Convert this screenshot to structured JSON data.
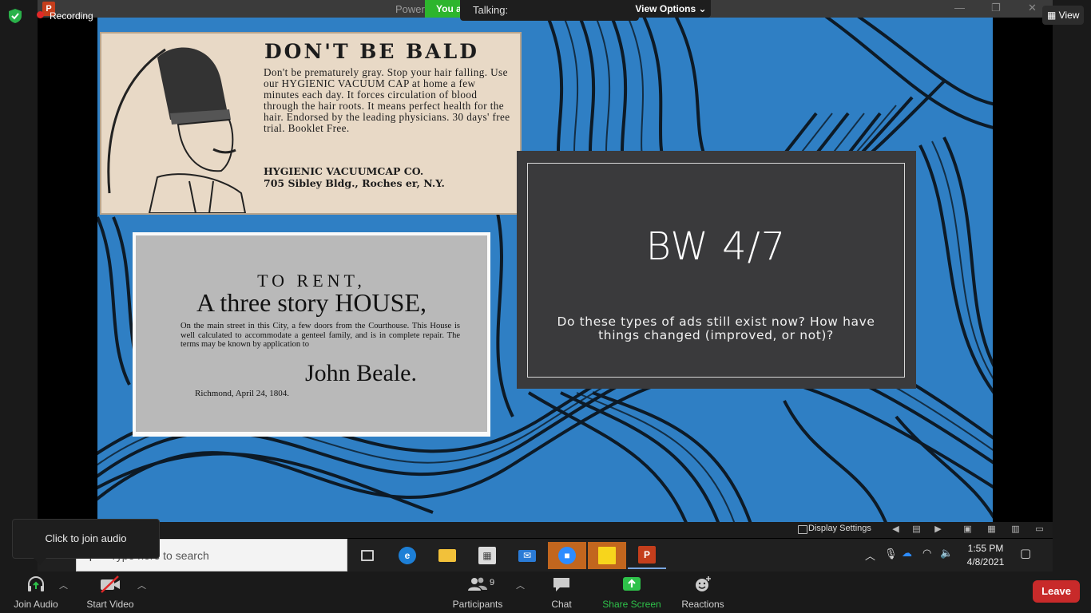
{
  "app": {
    "recording_label": "Recording",
    "view_label": "View",
    "view_options_label": "View Options",
    "talking_label": "Talking:",
    "join_audio_tooltip": "Click to join audio"
  },
  "ppt_window": {
    "title_partial": "Power",
    "you_badge": "You a",
    "minimize": "—",
    "restore": "❐",
    "close": "✕"
  },
  "slide": {
    "title": "BW 4/7",
    "subtitle": "Do these types of ads still exist now? How have things changed (improved, or not)?",
    "ad_bald": {
      "headline": "DON'T BE BALD",
      "body": "Don't be prematurely gray. Stop your hair falling. Use our HYGIENIC VACUUM CAP at home a few minutes each day. It forces circulation of blood through the hair roots. It means perfect health for the hair. Endorsed by the leading physicians. 30 days' free trial. Booklet Free.",
      "company": "HYGIENIC VACUUMCAP CO.",
      "address": "705 Sibley Bldg., Roches er, N.Y."
    },
    "ad_rent": {
      "line1": "TO RENT,",
      "line2": "A three story HOUSE,",
      "body": "On the main street in this City, a few doors from the Courthouse. This House is well calculated to accommodate a genteel family, and is in complete repair. The terms may be known by application to",
      "name": "John Beale.",
      "dateline": "Richmond, April 24, 1804."
    }
  },
  "slideshow_bar": {
    "display_settings": "Display Settings"
  },
  "taskbar": {
    "search_placeholder": "Type here to search",
    "time": "1:55 PM",
    "date": "4/8/2021"
  },
  "controls": {
    "join_audio": "Join Audio",
    "start_video": "Start Video",
    "participants": "Participants",
    "participants_count": "9",
    "chat": "Chat",
    "share_screen": "Share Screen",
    "reactions": "Reactions",
    "leave": "Leave"
  },
  "colors": {
    "share_green": "#2ec24a",
    "leave_red": "#c82a2a",
    "slide_blue": "#2f7fc4",
    "panel_gray": "#3a3a3c"
  }
}
